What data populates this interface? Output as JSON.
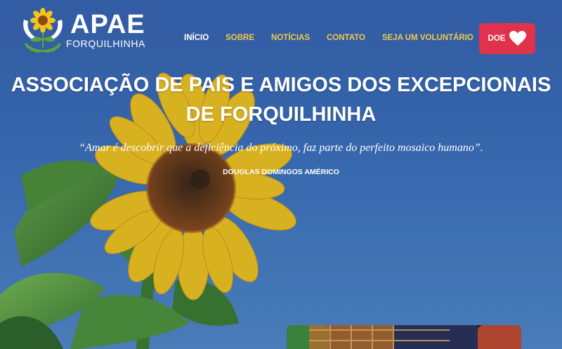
{
  "brand": {
    "name": "APAE",
    "city": "FORQUILHINHA"
  },
  "nav": {
    "items": [
      {
        "label": "INÍCIO",
        "active": true
      },
      {
        "label": "SOBRE",
        "active": false
      },
      {
        "label": "NOTÍCIAS",
        "active": false
      },
      {
        "label": "CONTATO",
        "active": false
      },
      {
        "label": "SEJA UM VOLUNTÁRIO",
        "active": false
      }
    ],
    "donate_label": "DOE"
  },
  "hero": {
    "title_line1": "ASSOCIAÇÃO DE PAIS E AMIGOS DOS EXCEPCIONAIS",
    "title_line2": "DE FORQUILHINHA",
    "quote": "“Amar é descobrir que a deficiência do próximo, faz parte do perfeito mosaico humano”.",
    "author": "DOUGLAS DOMINGOS AMÉRICO"
  },
  "colors": {
    "nav_link": "#f2c94c",
    "nav_active": "#ffffff",
    "donate_bg": "#e0324a",
    "sky": "#3a6bb4"
  },
  "icons": {
    "logo": "sunflower-hands-logo",
    "donate": "heart-icon"
  }
}
